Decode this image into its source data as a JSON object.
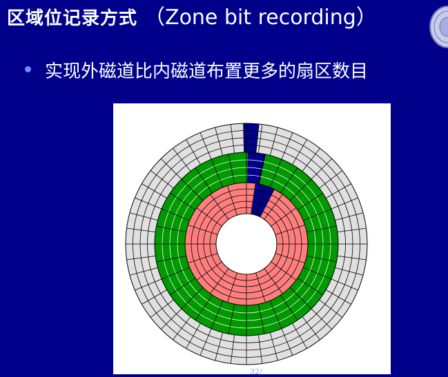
{
  "title": {
    "cn": "区域位记录方式",
    "en": "（Zone bit recording）"
  },
  "bullet": {
    "text": "实现外磁道比内磁道布置更多的扇区数目"
  },
  "figure": {
    "zones": [
      {
        "name": "outer-zone",
        "tracks": 4,
        "sectors": 48,
        "fill": "#e0e0e0"
      },
      {
        "name": "middle-zone",
        "tracks": 4,
        "sectors": 32,
        "fill": "#009900"
      },
      {
        "name": "inner-zone",
        "tracks": 5,
        "sectors": 20,
        "fill": "#ff7f7f"
      }
    ],
    "highlight_fill": "#00008b",
    "line_color": "#000000"
  },
  "footer": {
    "page_number": "32/"
  }
}
